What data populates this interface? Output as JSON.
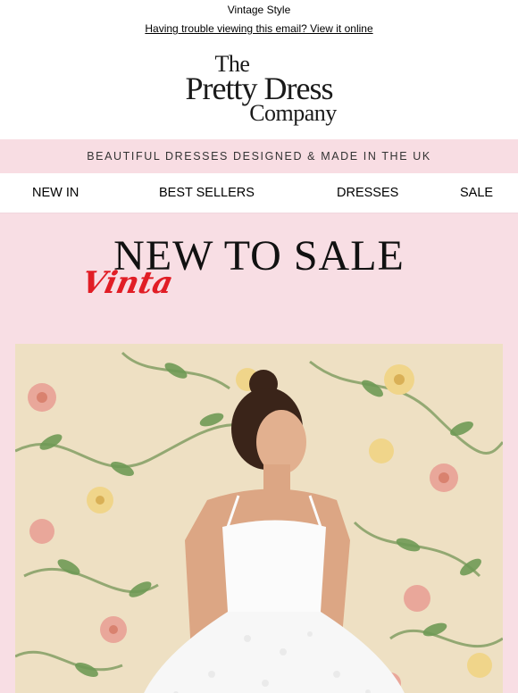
{
  "preheader": "Vintage Style",
  "view_online": "Having trouble viewing this email? View it online",
  "logo": {
    "line1": "The",
    "line2": "Pretty Dress",
    "line3": "Company"
  },
  "banner": "BEAUTIFUL DRESSES DESIGNED & MADE IN THE UK",
  "nav": {
    "new_in": "NEW IN",
    "best_sellers": "BEST SELLERS",
    "dresses": "DRESSES",
    "sale": "SALE"
  },
  "hero": {
    "title": "NEW TO SALE",
    "script": "Vinta"
  },
  "colors": {
    "banner_bg": "#f8dde3",
    "hero_bg": "#f8dee4",
    "script_red": "#e11d25"
  }
}
